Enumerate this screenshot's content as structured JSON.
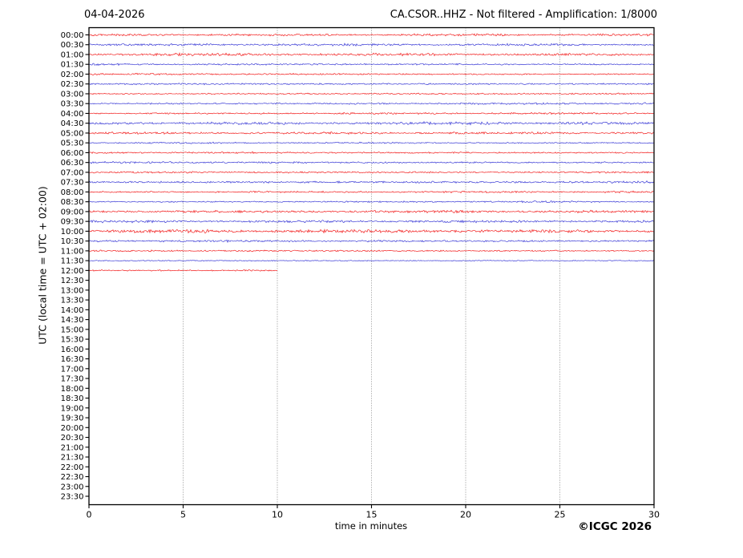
{
  "page": {
    "date_label": "04-04-2026",
    "title": "CA.CSOR..HHZ - Not filtered - Amplification: 1/8000",
    "copyright": "©ICGC 2026"
  },
  "chart_data": {
    "type": "line",
    "subtype": "helicorder-seismogram",
    "station_code": "CA.CSOR..HHZ",
    "filter_status": "Not filtered",
    "amplification": "1/8000",
    "date": "04-04-2026",
    "title": "CA.CSOR..HHZ - Not filtered - Amplification: 1/8000",
    "xlabel": "time in minutes",
    "ylabel": "UTC (local time = UTC + 02:00)",
    "xlim": [
      0,
      30
    ],
    "x_ticks": [
      0,
      5,
      10,
      15,
      20,
      25,
      30
    ],
    "grid_x": [
      5,
      10,
      15,
      20,
      25
    ],
    "grid_on": true,
    "y_tick_labels": [
      "00:00",
      "00:30",
      "01:00",
      "01:30",
      "02:00",
      "02:30",
      "03:00",
      "03:30",
      "04:00",
      "04:30",
      "05:00",
      "05:30",
      "06:00",
      "06:30",
      "07:00",
      "07:30",
      "08:00",
      "08:30",
      "09:00",
      "09:30",
      "10:00",
      "10:30",
      "11:00",
      "11:30",
      "12:00",
      "12:30",
      "13:00",
      "13:30",
      "14:00",
      "14:30",
      "15:00",
      "15:30",
      "16:00",
      "16:30",
      "17:00",
      "17:30",
      "18:00",
      "18:30",
      "19:00",
      "19:30",
      "20:00",
      "20:30",
      "21:00",
      "21:30",
      "22:00",
      "22:30",
      "23:00",
      "23:30"
    ],
    "trace_colors": {
      "red": "#f00000",
      "blue": "#2020d0"
    },
    "traces": [
      {
        "time": "00:00",
        "color": "red",
        "start_minute": 0,
        "end_minute": 30,
        "amplitude": 0.9
      },
      {
        "time": "00:30",
        "color": "blue",
        "start_minute": 0,
        "end_minute": 30,
        "amplitude": 0.9
      },
      {
        "time": "01:00",
        "color": "red",
        "start_minute": 0,
        "end_minute": 30,
        "amplitude": 1.1
      },
      {
        "time": "01:30",
        "color": "blue",
        "start_minute": 0,
        "end_minute": 30,
        "amplitude": 0.8
      },
      {
        "time": "02:00",
        "color": "red",
        "start_minute": 0,
        "end_minute": 30,
        "amplitude": 0.9
      },
      {
        "time": "02:30",
        "color": "blue",
        "start_minute": 0,
        "end_minute": 30,
        "amplitude": 1.0
      },
      {
        "time": "03:00",
        "color": "red",
        "start_minute": 0,
        "end_minute": 30,
        "amplitude": 0.9
      },
      {
        "time": "03:30",
        "color": "blue",
        "start_minute": 0,
        "end_minute": 30,
        "amplitude": 0.9
      },
      {
        "time": "04:00",
        "color": "red",
        "start_minute": 0,
        "end_minute": 30,
        "amplitude": 0.8
      },
      {
        "time": "04:30",
        "color": "blue",
        "start_minute": 0,
        "end_minute": 30,
        "amplitude": 1.1
      },
      {
        "time": "05:00",
        "color": "red",
        "start_minute": 0,
        "end_minute": 30,
        "amplitude": 0.9
      },
      {
        "time": "05:30",
        "color": "blue",
        "start_minute": 0,
        "end_minute": 30,
        "amplitude": 0.6
      },
      {
        "time": "06:00",
        "color": "red",
        "start_minute": 0,
        "end_minute": 30,
        "amplitude": 0.8
      },
      {
        "time": "06:30",
        "color": "blue",
        "start_minute": 0,
        "end_minute": 30,
        "amplitude": 1.0
      },
      {
        "time": "07:00",
        "color": "red",
        "start_minute": 0,
        "end_minute": 30,
        "amplitude": 1.1
      },
      {
        "time": "07:30",
        "color": "blue",
        "start_minute": 0,
        "end_minute": 30,
        "amplitude": 1.2
      },
      {
        "time": "08:00",
        "color": "red",
        "start_minute": 0,
        "end_minute": 30,
        "amplitude": 0.9
      },
      {
        "time": "08:30",
        "color": "blue",
        "start_minute": 0,
        "end_minute": 30,
        "amplitude": 0.7
      },
      {
        "time": "09:00",
        "color": "red",
        "start_minute": 0,
        "end_minute": 30,
        "amplitude": 1.0
      },
      {
        "time": "09:30",
        "color": "blue",
        "start_minute": 0,
        "end_minute": 30,
        "amplitude": 1.0
      },
      {
        "time": "10:00",
        "color": "red",
        "start_minute": 0,
        "end_minute": 30,
        "amplitude": 1.4
      },
      {
        "time": "10:30",
        "color": "blue",
        "start_minute": 0,
        "end_minute": 30,
        "amplitude": 1.0
      },
      {
        "time": "11:00",
        "color": "red",
        "start_minute": 0,
        "end_minute": 30,
        "amplitude": 0.9
      },
      {
        "time": "11:30",
        "color": "blue",
        "start_minute": 0,
        "end_minute": 30,
        "amplitude": 0.6
      },
      {
        "time": "12:00",
        "color": "red",
        "start_minute": 0,
        "end_minute": 10,
        "amplitude": 0.9
      }
    ]
  }
}
